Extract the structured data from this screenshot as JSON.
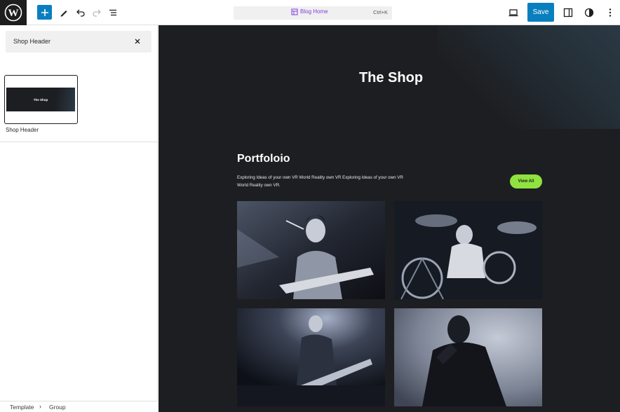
{
  "toolbar": {
    "document_title": "Blog Home",
    "shortcut": "Ctrl+K",
    "save_label": "Save",
    "accent_color": "#0a7fbf"
  },
  "sidebar": {
    "search_value": "Shop Header",
    "pattern_preview_title": "The Shop",
    "pattern_label": "Shop Header"
  },
  "breadcrumb": [
    "Template",
    "Group"
  ],
  "canvas": {
    "hero_title": "The Shop",
    "portfolio_title": "Portfoloio",
    "portfolio_description": "Exploring Ideas of your own VR World Reality own VR Exploring Ideas of your own VR World Reality own VR.",
    "view_all_label": "View All",
    "view_all_color": "#8fe23f",
    "photos": [
      "guitarist-singing-photo",
      "drummer-photo",
      "guitarist-stage-photo",
      "masked-singer-photo"
    ]
  }
}
